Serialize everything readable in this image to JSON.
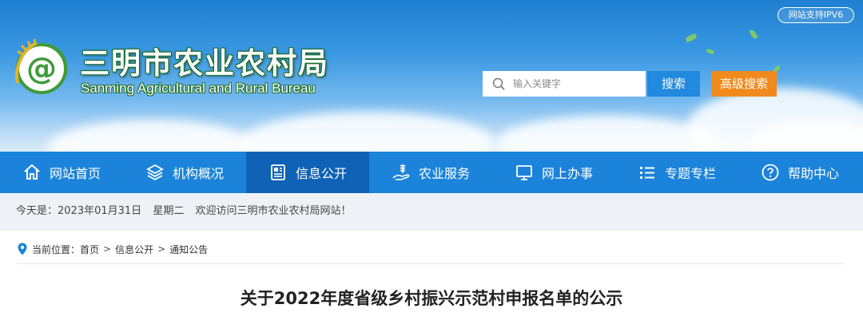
{
  "header": {
    "ipv6_badge": "网站支持IPV6",
    "title": "三明市农业农村局",
    "subtitle": "Sanming Agricultural and Rural Bureau",
    "search": {
      "placeholder": "输入关键字",
      "search_button": "搜索",
      "advanced_button": "高级搜索"
    }
  },
  "nav": {
    "items": [
      {
        "label": "网站首页",
        "icon": "home-icon"
      },
      {
        "label": "机构概况",
        "icon": "layers-icon"
      },
      {
        "label": "信息公开",
        "icon": "document-icon",
        "active": true
      },
      {
        "label": "农业服务",
        "icon": "wheat-hand-icon"
      },
      {
        "label": "网上办事",
        "icon": "monitor-icon"
      },
      {
        "label": "专题专栏",
        "icon": "list-icon"
      },
      {
        "label": "帮助中心",
        "icon": "help-icon"
      }
    ]
  },
  "datebar": {
    "date": "今天是：2023年01月31日",
    "weekday": "星期二",
    "welcome": "欢迎访问三明市农业农村局网站！"
  },
  "breadcrumb": {
    "prefix": "当前位置：",
    "items": [
      "首页",
      "信息公开",
      "通知公告"
    ],
    "separator": ">"
  },
  "article": {
    "title": "关于2022年度省级乡村振兴示范村申报名单的公示"
  },
  "colors": {
    "nav_bg": "#1b83da",
    "nav_active": "#0f62b5",
    "search_button": "#2189de",
    "advanced_button": "#f08a1c",
    "logo_green": "#3f9b3a"
  }
}
